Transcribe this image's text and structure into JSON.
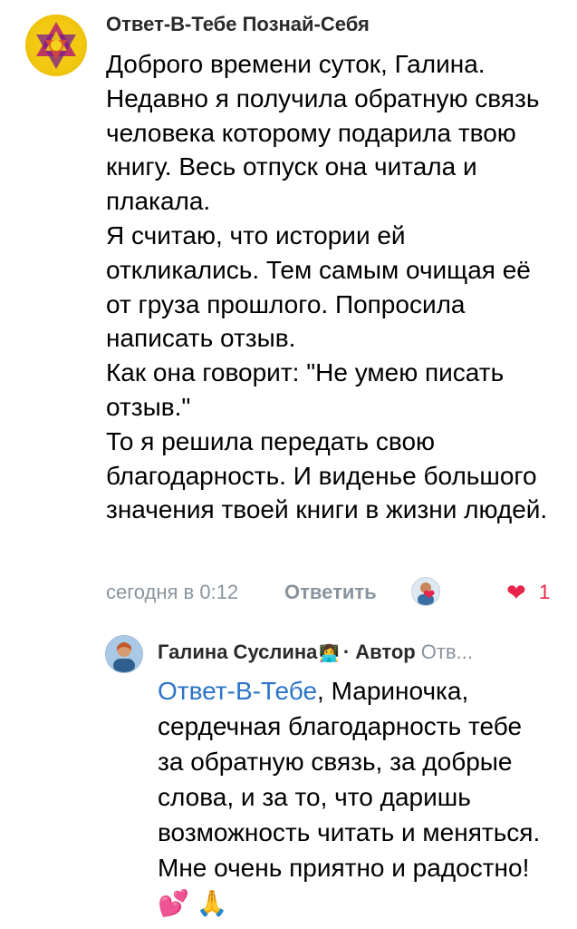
{
  "comment": {
    "author": "Ответ-В-Тебе Познай-Себя",
    "text": "Доброго времени суток, Галина.\nНедавно я получила обратную связь человека которому подарила твою книгу. Весь отпуск она читала и плакала.\nЯ считаю, что истории ей откликались. Тем самым очищая её от груза прошлого. Попросила написать отзыв.\nКак она говорит: \"Не умею писать отзыв.\"\nТо я решила передать свою благодарность. И виденье большого значения твоей книги в жизни людей.",
    "time": "сегодня в 0:12",
    "reply_label": "Ответить",
    "like_icon": "heart-icon",
    "like_count": "1",
    "avatar_icon": "hexagram-logo"
  },
  "reply": {
    "author": "Галина Суслина",
    "role_icon": "👩‍💻",
    "badge": "· Автор",
    "truncated": "Отв...",
    "mention": "Ответ-В-Тебе",
    "text": ", Мариночка, сердечная благодарность тебе за обратную связь, за добрые слова, и за то, что даришь возможность читать и меняться. Мне очень приятно и радостно! ",
    "emojis": "💕 🙏"
  },
  "colors": {
    "accent": "#2b74c7",
    "muted": "#8a949e",
    "like": "#e8234a",
    "logo_bg": "#f2c811"
  }
}
